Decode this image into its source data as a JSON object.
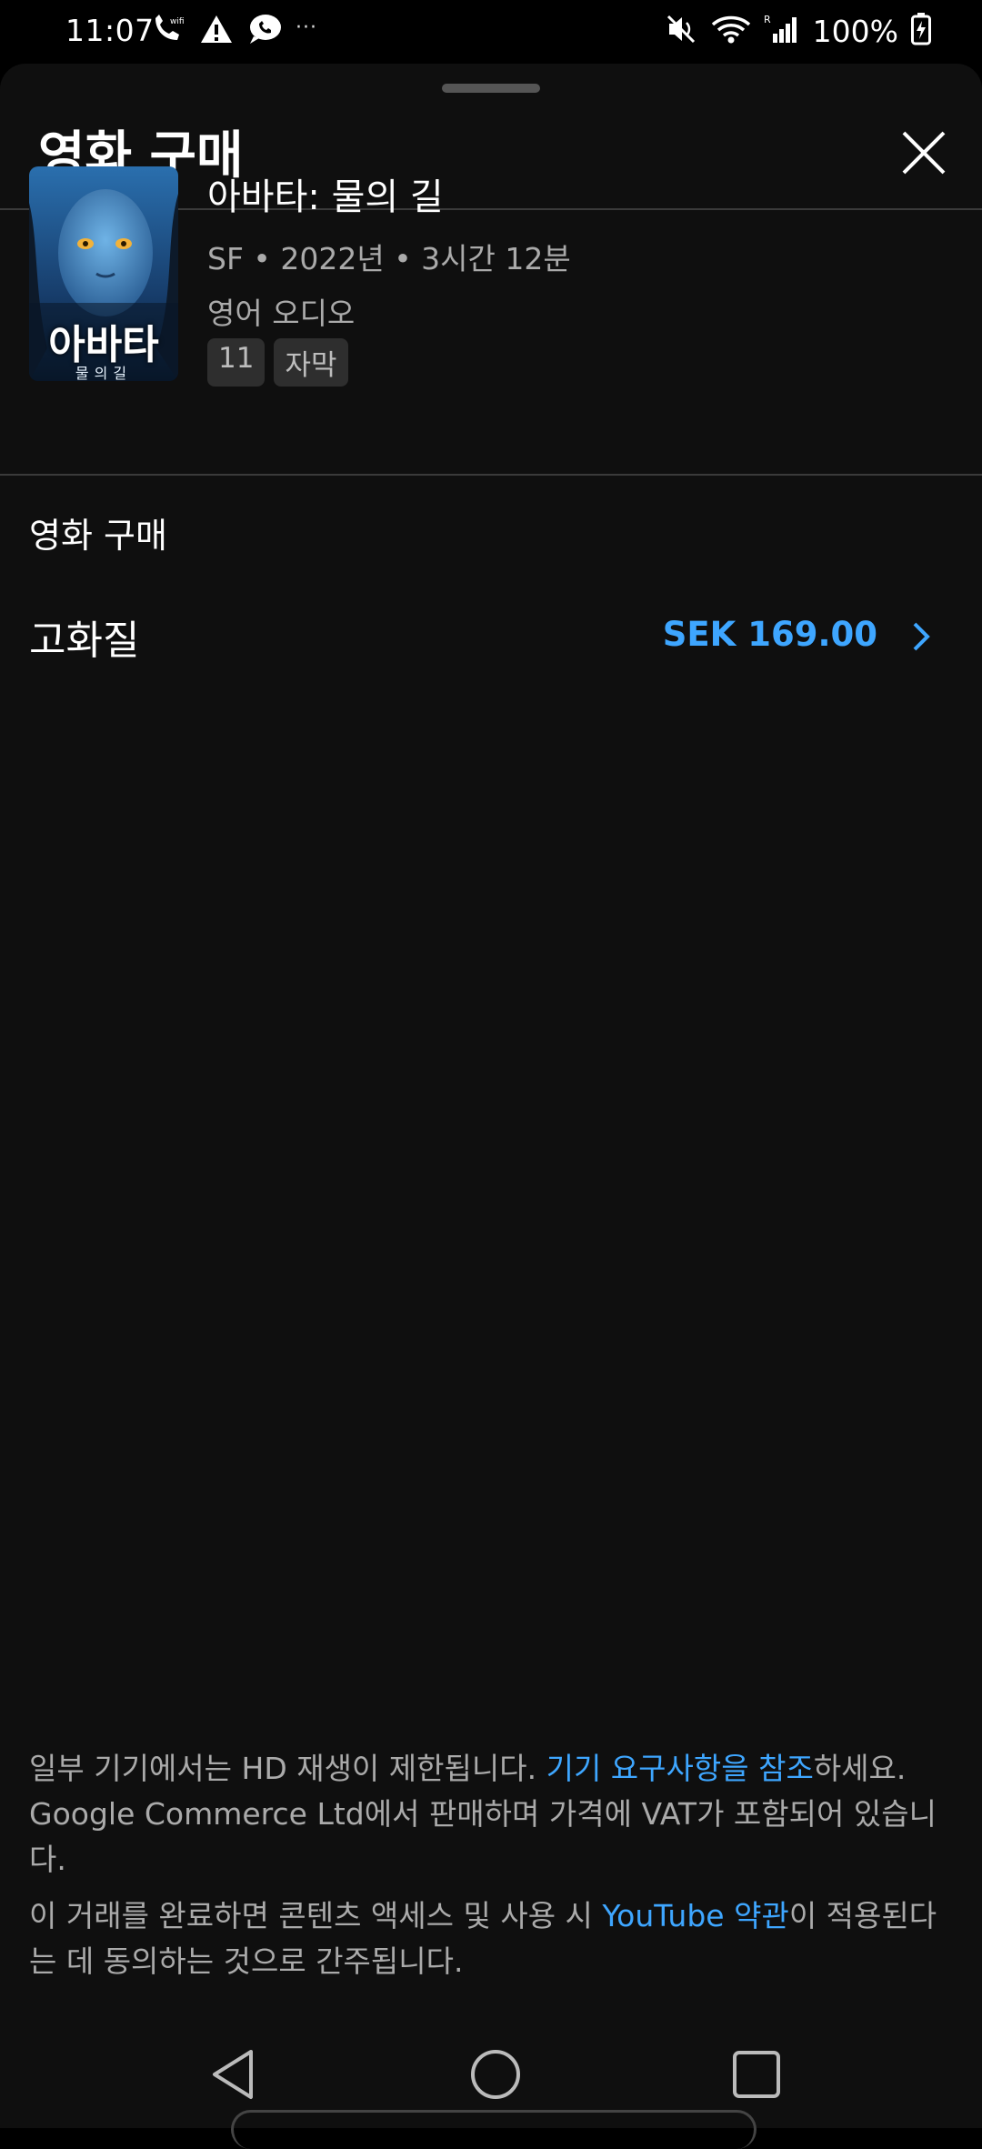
{
  "status_bar": {
    "time": "11:07",
    "battery": "100%",
    "icons": [
      "wifi-calling-icon",
      "warning-icon",
      "chat-bubble-icon",
      "more-dots-icon",
      "mute-icon",
      "wifi-icon",
      "signal-icon",
      "battery-charging-icon"
    ]
  },
  "sheet": {
    "title": "영화 구매",
    "close_icon": "close-icon"
  },
  "movie": {
    "title": "아바타: 물의 길",
    "meta": "SF • 2022년 • 3시간 12분",
    "audio": "영어 오디오",
    "badges": [
      "11",
      "자막"
    ],
    "poster_title": "아바타",
    "poster_subtitle": "물의길"
  },
  "purchase": {
    "section_label": "영화 구매",
    "option": {
      "label": "고화질",
      "price": "SEK 169.00"
    }
  },
  "footer": {
    "line1_text": "일부 기기에서는 HD 재생이 제한됩니다. ",
    "line1_link": "기기 요구사항을 참조",
    "line1_suffix": "하세요. Google Commerce Ltd에서 판매하며 가격에 VAT가 포함되어 있습니다.",
    "line2_text": "이 거래를 완료하면 콘텐츠 액세스 및 사용 시 ",
    "line2_link": "YouTube 약관",
    "line2_suffix": "이 적용된다는 데 동의하는 것으로 간주됩니다."
  },
  "colors": {
    "background": "#0f0f0f",
    "accent": "#3ea6ff",
    "secondary_text": "#aaaaaa"
  }
}
